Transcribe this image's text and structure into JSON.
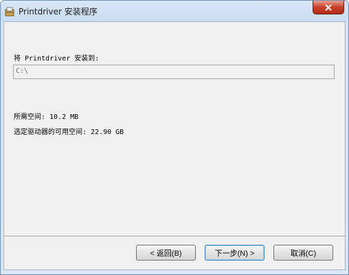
{
  "window": {
    "title": "Printdriver 安装程序",
    "colors": {
      "titlebar": "#d9e7f7",
      "close": "#c8402a",
      "client": "#f0f0f0"
    }
  },
  "content": {
    "install_label": "将 Printdriver 安装到:",
    "path_value": "C:\\",
    "space_required": "所需空间: 10.2 MB",
    "space_available": "选定驱动器的可用空间: 22.90 GB"
  },
  "buttons": {
    "back": "< 返回(B)",
    "next": "下一步(N) >",
    "cancel": "取消(C)"
  },
  "icons": {
    "app": "installer-icon",
    "close": "close-icon"
  }
}
